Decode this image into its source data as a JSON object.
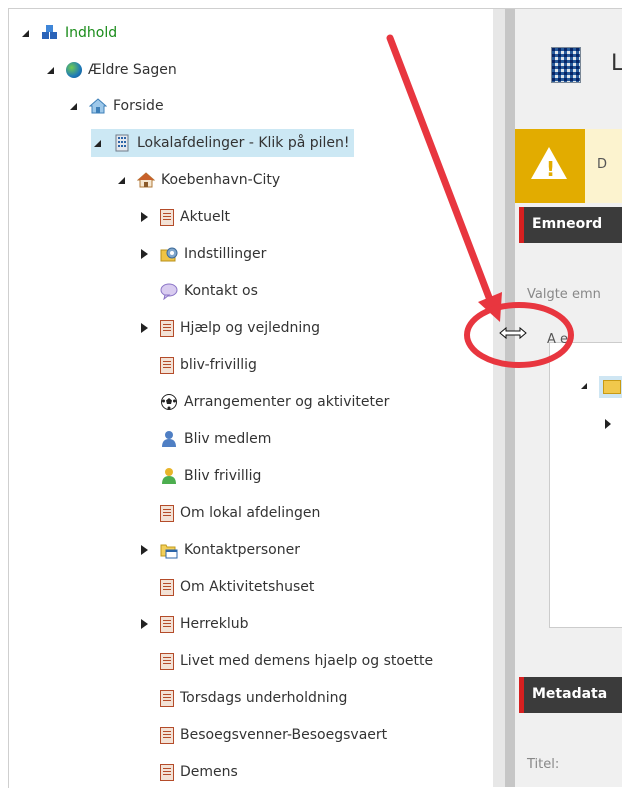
{
  "tree": {
    "items": [
      {
        "label": "Indhold",
        "icon": "content-tree-icon",
        "expanded": true
      },
      {
        "label": "Ældre Sagen",
        "icon": "globe-icon",
        "expanded": true
      },
      {
        "label": "Forside",
        "icon": "home-icon",
        "expanded": true
      },
      {
        "label": "Lokalafdelinger - Klik på pilen!",
        "icon": "building-icon",
        "expanded": true,
        "selected": true
      },
      {
        "label": "Koebenhavn-City",
        "icon": "house-icon",
        "expanded": true
      },
      {
        "label": "Aktuelt",
        "icon": "document-icon",
        "expanded": false
      },
      {
        "label": "Indstillinger",
        "icon": "settings-folder-icon",
        "expanded": false
      },
      {
        "label": "Kontakt os",
        "icon": "chat-bubble-icon"
      },
      {
        "label": "Hjælp og vejledning",
        "icon": "document-icon",
        "expanded": false
      },
      {
        "label": "bliv-frivillig",
        "icon": "document-icon"
      },
      {
        "label": "Arrangementer og aktiviteter",
        "icon": "soccer-ball-icon"
      },
      {
        "label": "Bliv medlem",
        "icon": "person-blue-icon"
      },
      {
        "label": "Bliv frivillig",
        "icon": "person-yellow-icon"
      },
      {
        "label": "Om lokal afdelingen",
        "icon": "document-icon"
      },
      {
        "label": "Kontaktpersoner",
        "icon": "folder-window-icon",
        "expanded": false
      },
      {
        "label": "Om Aktivitetshuset",
        "icon": "document-icon"
      },
      {
        "label": "Herreklub",
        "icon": "document-icon",
        "expanded": false
      },
      {
        "label": "Livet med demens hjaelp og stoette",
        "icon": "document-icon"
      },
      {
        "label": "Torsdags underholdning",
        "icon": "document-icon"
      },
      {
        "label": "Besoegsvenner-Besoegsvaert",
        "icon": "document-icon"
      },
      {
        "label": "Demens",
        "icon": "document-icon"
      }
    ]
  },
  "right_panel": {
    "title_fragment": "L",
    "warning_fragment": "D",
    "sections": {
      "emneord": "Emneord",
      "metadata": "Metadata"
    },
    "selected_label": "Valgte emn",
    "all_label": "A e",
    "title_field_label": "Titel:"
  },
  "colors": {
    "selected_bg": "#cce8f4",
    "root_label": "#1a8c1a",
    "section_bar": "#3b3b3b",
    "section_accent": "#d62020",
    "warning": "#e2ac00",
    "annotation": "#e8363f"
  }
}
